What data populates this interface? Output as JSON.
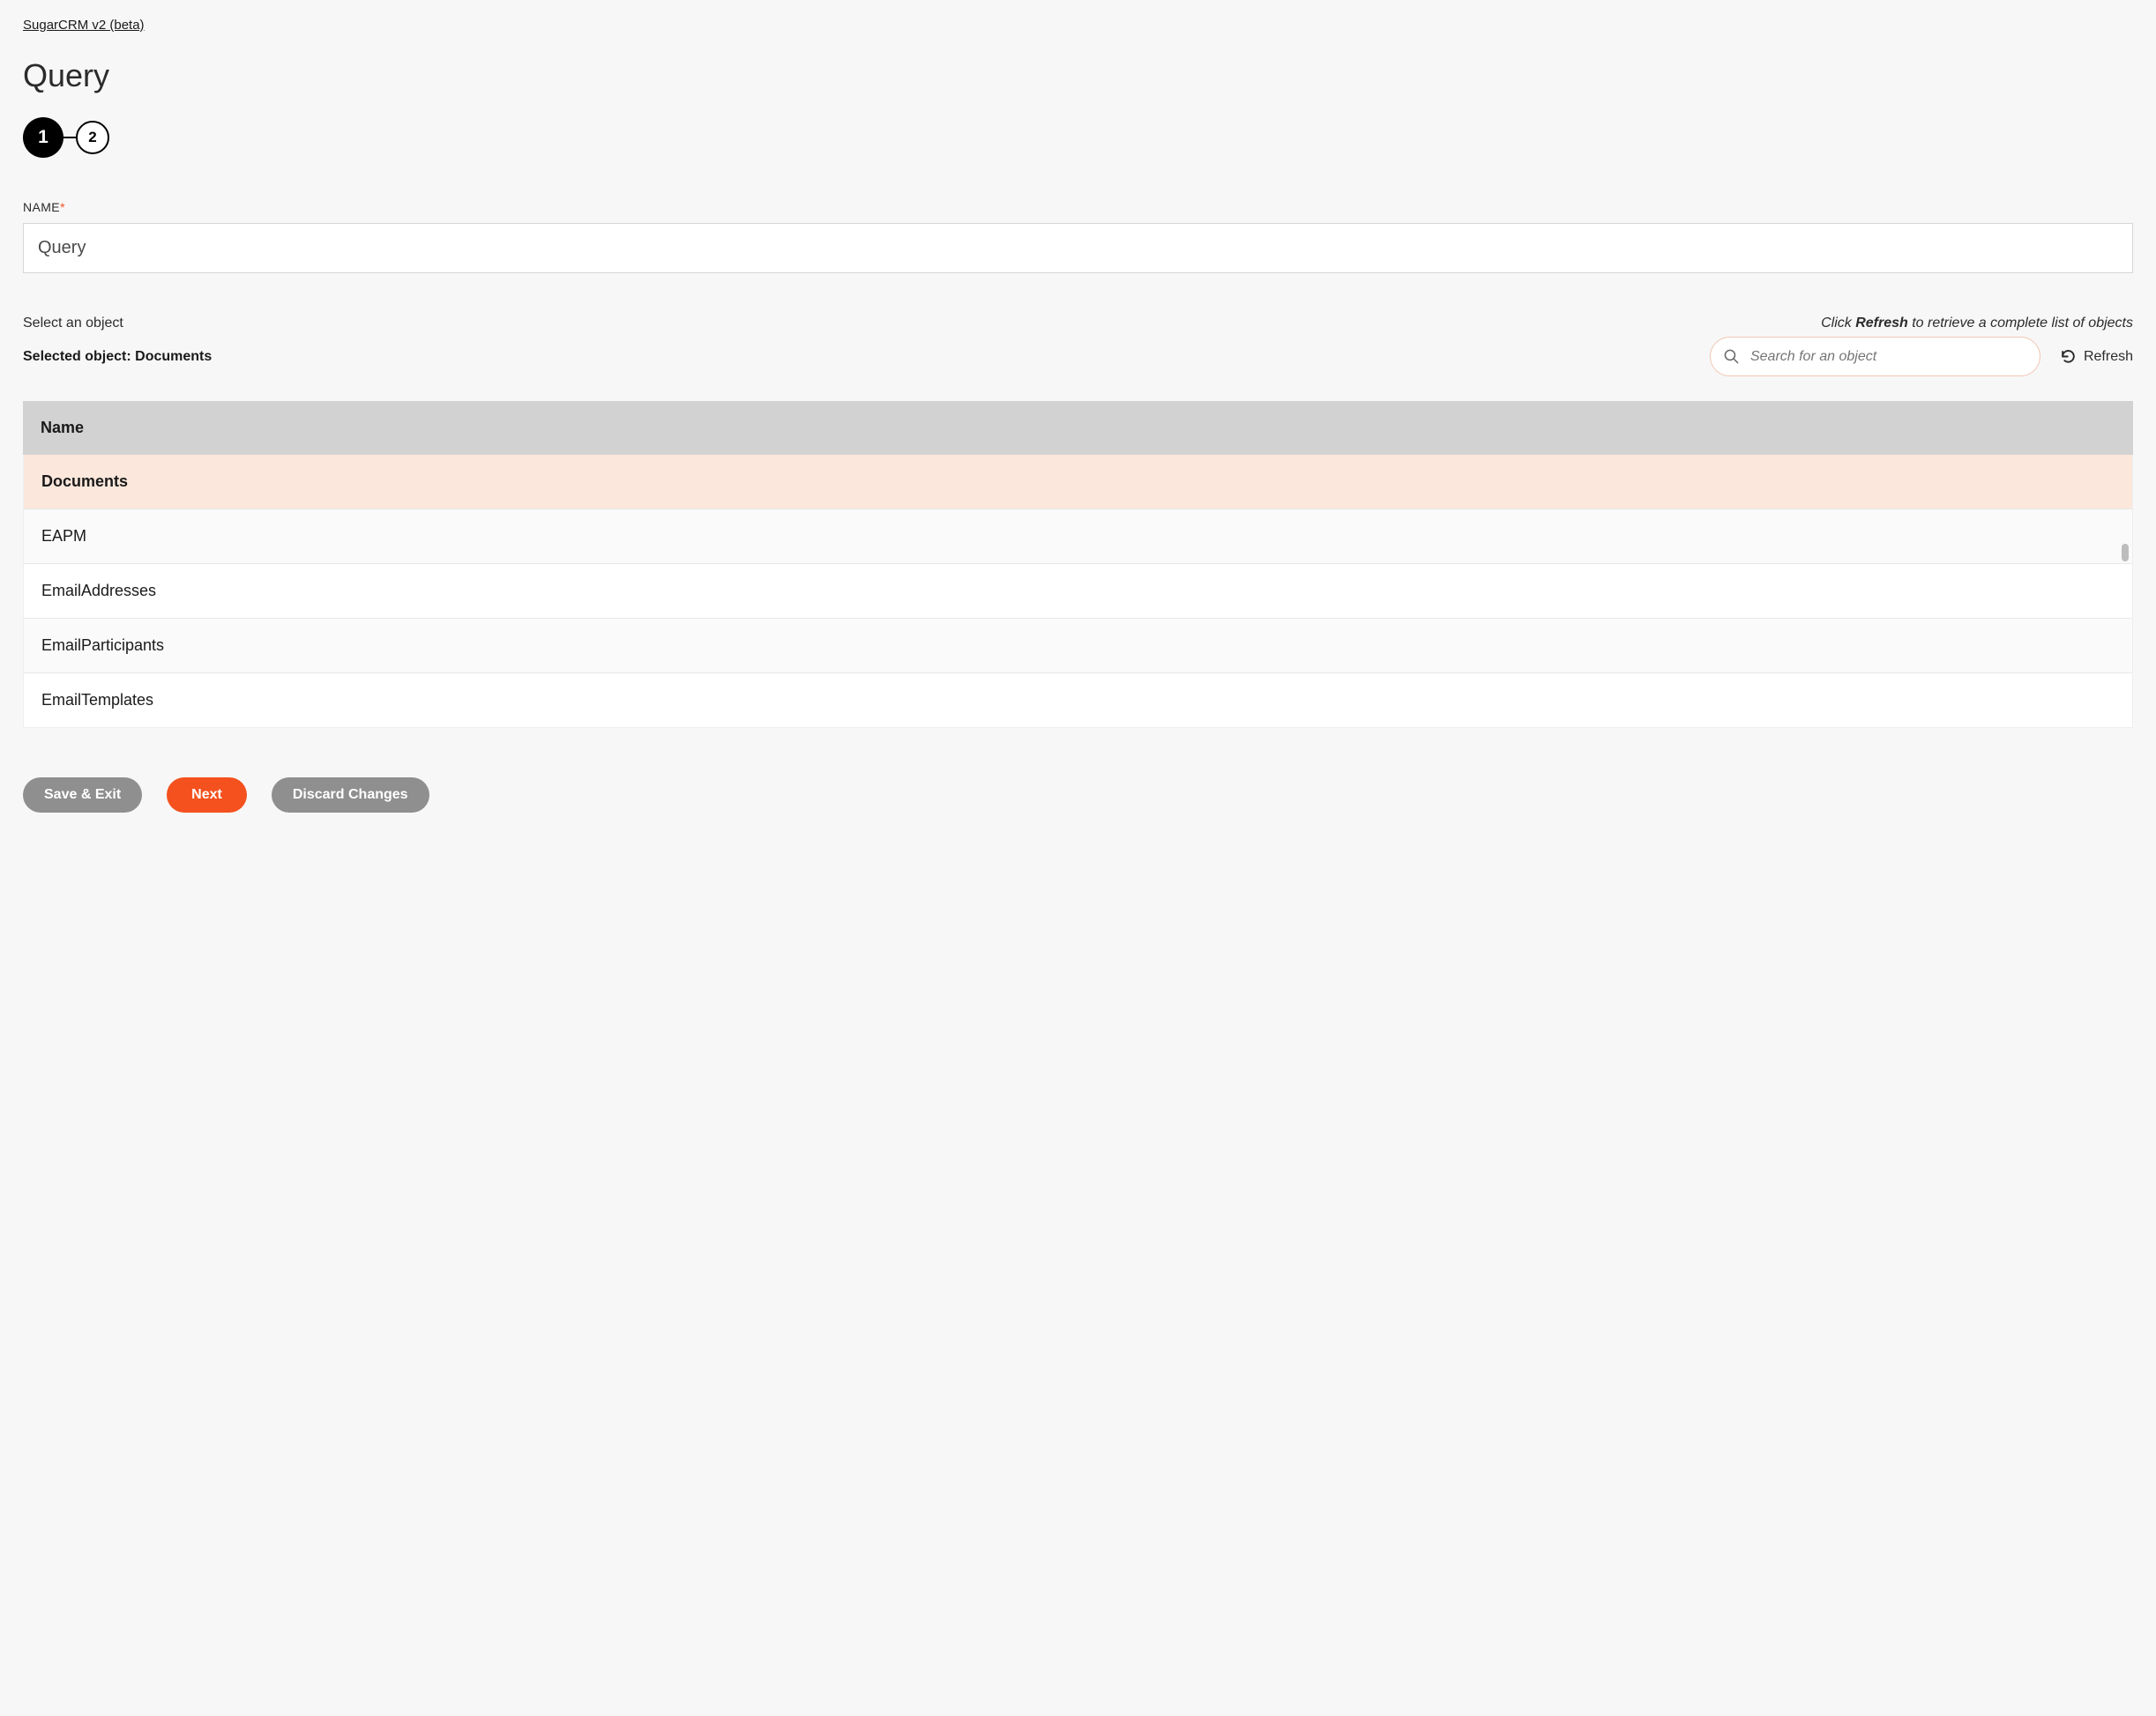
{
  "breadcrumb": "SugarCRM v2 (beta)",
  "page_title": "Query",
  "stepper": {
    "current": "1",
    "next": "2"
  },
  "name_field": {
    "label": "NAME",
    "required_mark": "*",
    "value": "Query"
  },
  "object_section": {
    "select_label": "Select an object",
    "refresh_hint_prefix": "Click ",
    "refresh_hint_bold": "Refresh",
    "refresh_hint_suffix": " to retrieve a complete list of objects",
    "selected_prefix": "Selected object: ",
    "selected_value": "Documents",
    "search_placeholder": "Search for an object",
    "refresh_label": "Refresh"
  },
  "table": {
    "header": "Name",
    "rows": [
      {
        "name": "Documents",
        "selected": true
      },
      {
        "name": "EAPM",
        "selected": false
      },
      {
        "name": "EmailAddresses",
        "selected": false
      },
      {
        "name": "EmailParticipants",
        "selected": false
      },
      {
        "name": "EmailTemplates",
        "selected": false
      }
    ]
  },
  "buttons": {
    "save_exit": "Save & Exit",
    "next": "Next",
    "discard": "Discard Changes"
  }
}
